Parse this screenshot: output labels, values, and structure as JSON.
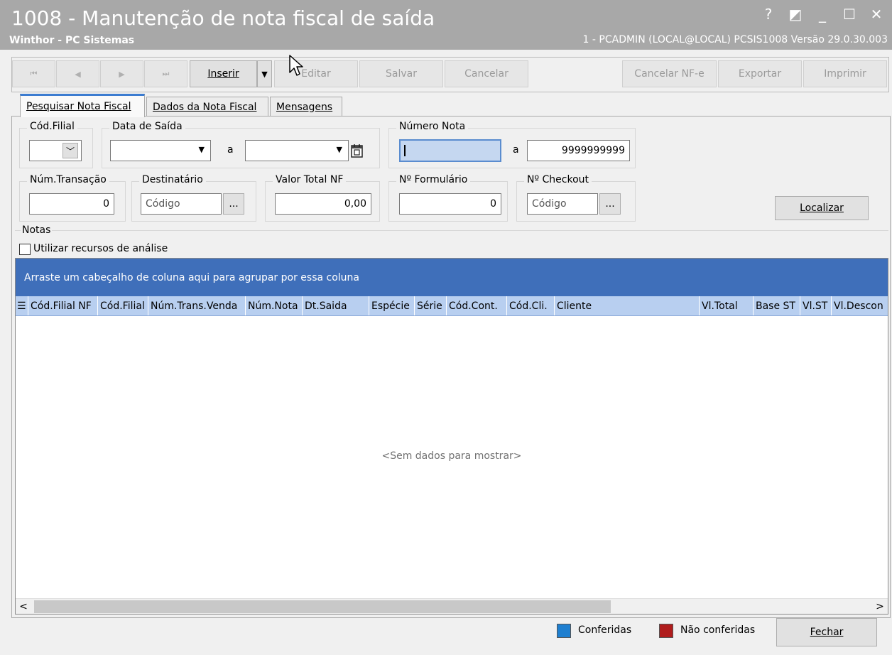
{
  "window": {
    "title": "1008 - Manutenção de nota fiscal de saída",
    "subtitle": "Winthor - PC Sistemas",
    "userinfo": "1 - PCADMIN (LOCAL@LOCAL)  PCSIS1008  Versão  29.0.30.003",
    "buttons": {
      "help": "?",
      "restore": "◩",
      "minimize": "_",
      "maximize": "☐",
      "close": "✕"
    }
  },
  "toolbar": {
    "first": "⏮",
    "prev": "◀",
    "next": "▶",
    "last": "⏭",
    "insert": "Inserir",
    "insert_dropdown": "▼",
    "edit": "Editar",
    "save": "Salvar",
    "cancel": "Cancelar",
    "cancel_nfe": "Cancelar NF-e",
    "export": "Exportar",
    "print": "Imprimir"
  },
  "tabs": [
    "Pesquisar Nota Fiscal",
    "Dados da Nota Fiscal",
    "Mensagens"
  ],
  "filters": {
    "filial_label": "Cód.Filial",
    "data_saida_label": "Data de Saída",
    "data_saida_sep": "a",
    "numero_nota_label": "Número Nota",
    "numero_nota_from": "",
    "numero_nota_sep": "a",
    "numero_nota_to": "9999999999",
    "num_transacao_label": "Núm.Transação",
    "num_transacao_value": "0",
    "destinatario_label": "Destinatário",
    "destinatario_placeholder": "Código",
    "valor_total_label": "Valor Total NF",
    "valor_total_value": "0,00",
    "formulario_label": "Nº Formulário",
    "formulario_value": "0",
    "checkout_label": "Nº Checkout",
    "checkout_placeholder": "Código",
    "lookup_btn": "...",
    "localizar": "Localizar"
  },
  "notas": {
    "label": "Notas",
    "analise_checkbox": "Utilizar recursos de análise",
    "group_hint": "Arraste um cabeçalho de coluna aqui para agrupar por essa coluna",
    "columns": [
      "Cód.Filial NF",
      "Cód.Filial",
      "Núm.Trans.Venda",
      "Núm.Nota",
      "Dt.Saida",
      "Espécie",
      "Série",
      "Cód.Cont.",
      "Cód.Cli.",
      "Cliente",
      "Vl.Total",
      "Base ST",
      "Vl.ST",
      "Vl.Descon"
    ],
    "empty": "<Sem dados para mostrar>"
  },
  "legend": {
    "conferidas": "Conferidas",
    "conferidas_color": "#1e7fd0",
    "nao_conferidas": "Não conferidas",
    "nao_conferidas_color": "#b01c1c"
  },
  "footer": {
    "close": "Fechar"
  },
  "accent": "#3f6fba"
}
